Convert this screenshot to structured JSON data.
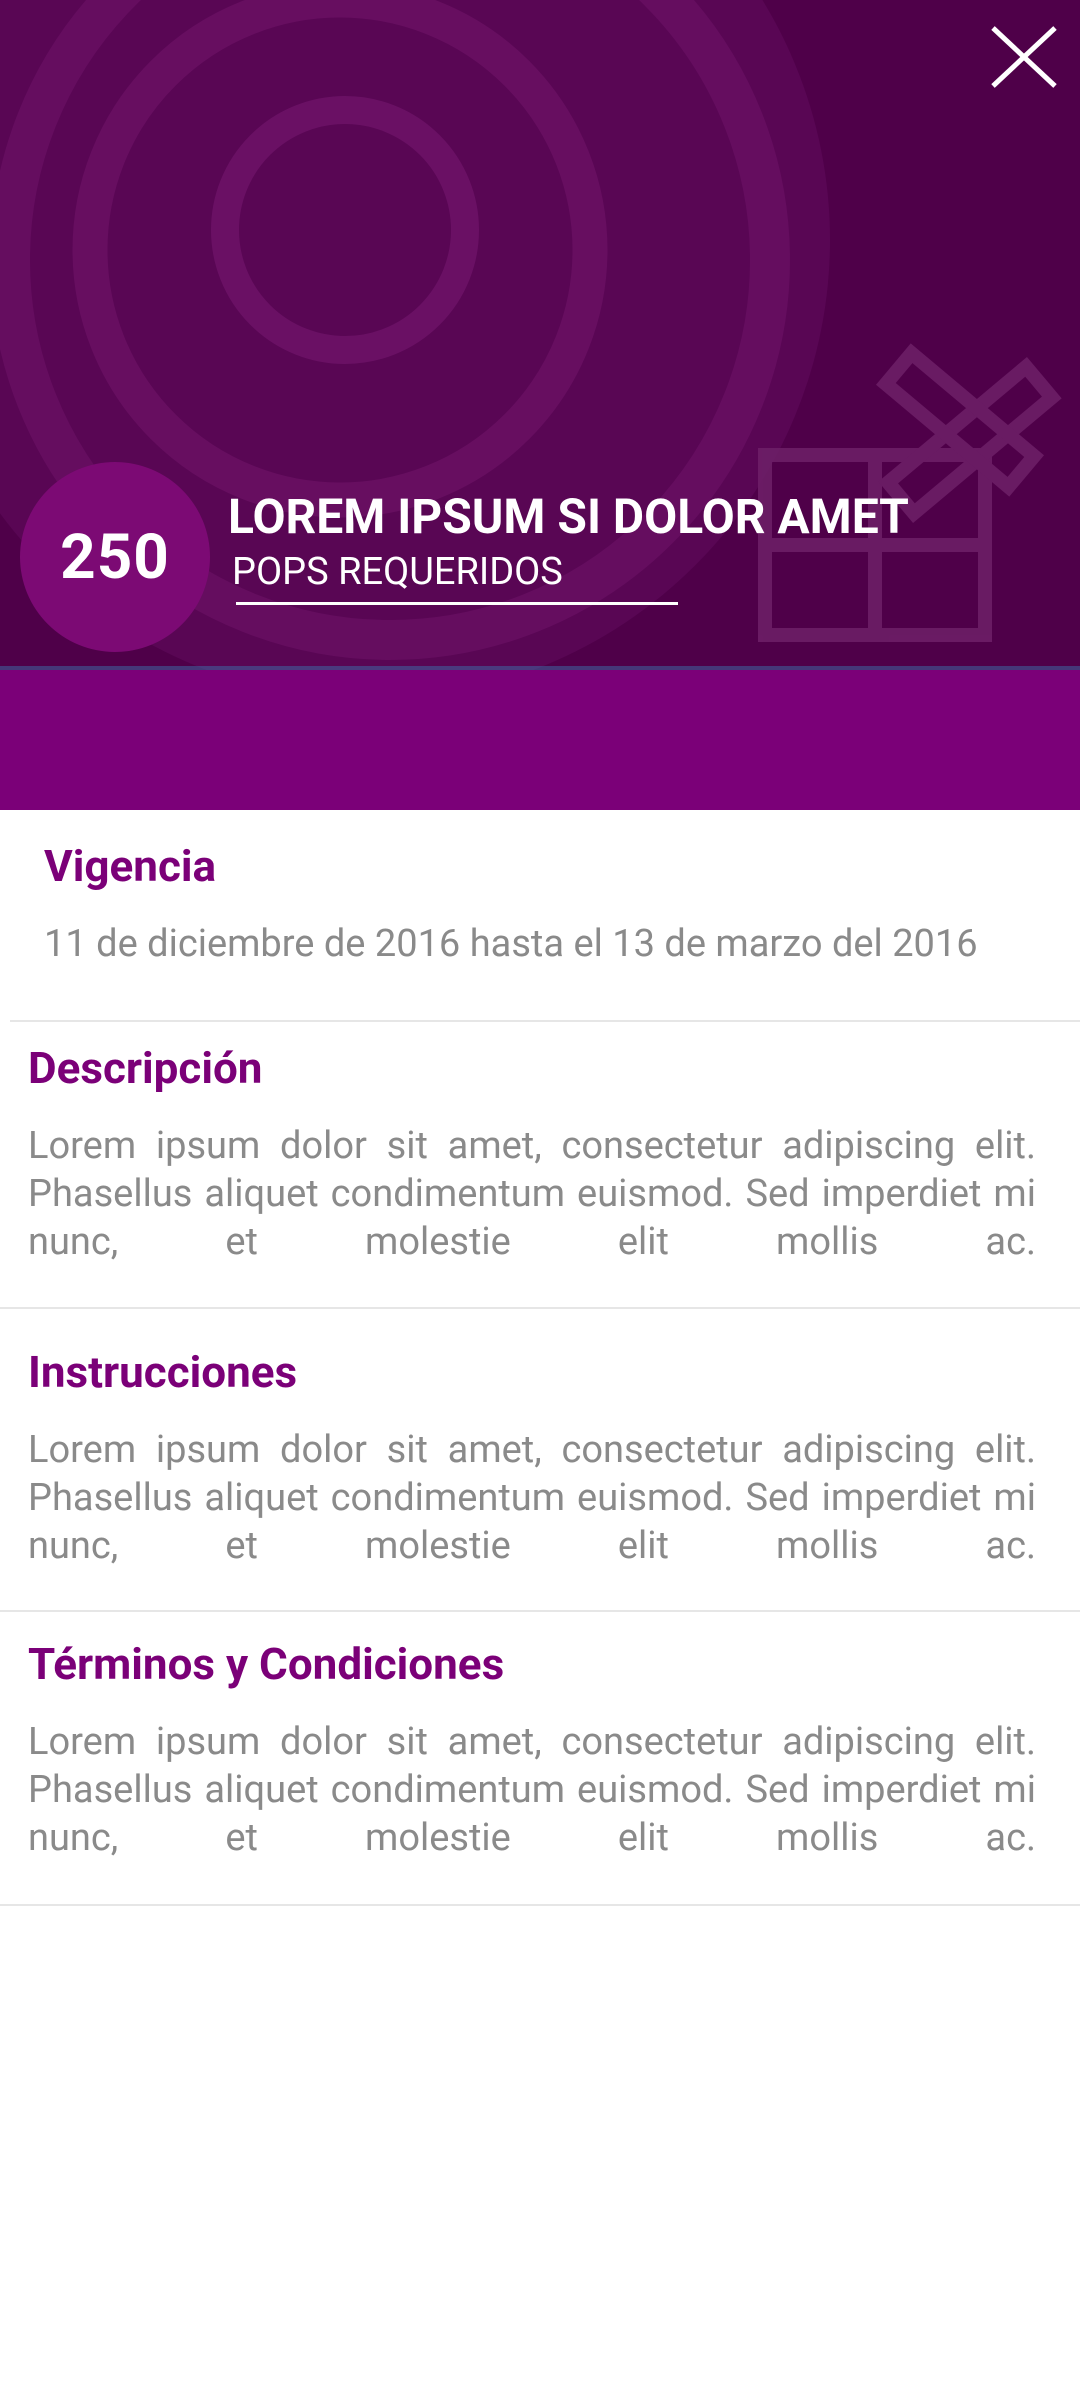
{
  "header": {
    "close_icon": "close-icon",
    "points": "250",
    "title": "LOREM IPSUM SI DOLOR AMET",
    "subtitle": "POPS REQUERIDOS",
    "background_color": "#4f0049",
    "band_color": "#7b0078"
  },
  "sections": {
    "vigencia": {
      "title": "Vigencia",
      "text": "11 de diciembre de 2016 hasta el 13 de marzo del 2016"
    },
    "descripcion": {
      "title": "Descripción",
      "text": "Lorem ipsum dolor sit amet, consectetur adipiscing elit. Phasellus aliquet condimentum euismod. Sed imperdiet mi nunc, et molestie elit mollis ac."
    },
    "instrucciones": {
      "title": "Instrucciones",
      "text": "Lorem ipsum dolor sit amet, consectetur adipiscing elit. Phasellus aliquet condimentum euismod. Sed imperdiet mi nunc, et molestie elit mollis ac."
    },
    "terminos": {
      "title": "Términos y Condiciones",
      "text": "Lorem ipsum dolor sit amet, consectetur adipiscing elit. Phasellus aliquet condimentum euismod. Sed imperdiet mi nunc, et molestie elit mollis ac."
    }
  },
  "accent_color": "#7b0078",
  "body_text_color": "#8a8a8a"
}
